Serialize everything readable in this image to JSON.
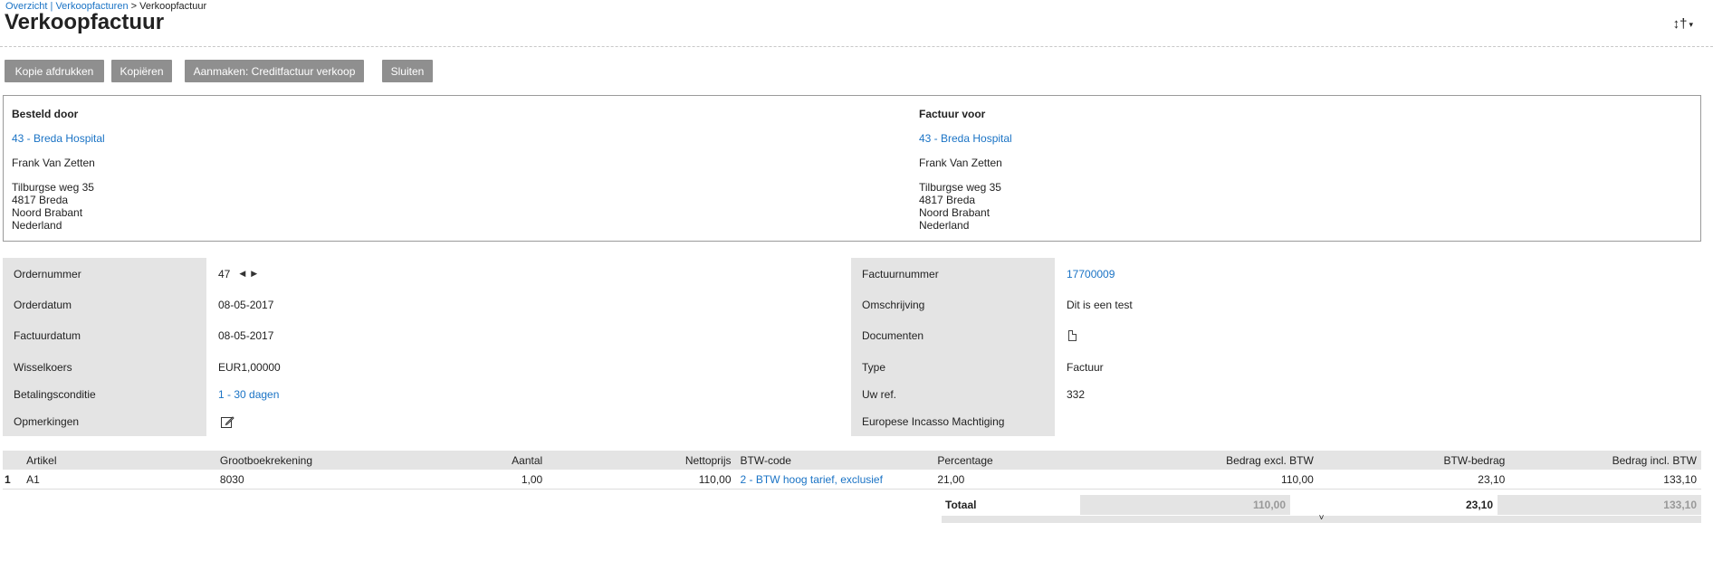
{
  "breadcrumb": {
    "item1": "Overzicht",
    "sep1": " | ",
    "item2": "Verkoopfacturen",
    "sep2": " > ",
    "current": "Verkoopfactuur"
  },
  "page": {
    "title": "Verkoopfactuur"
  },
  "tools": {
    "icon": "↕†",
    "caret": "▾"
  },
  "buttons": {
    "print": "Kopie afdrukken",
    "copy": "Kopiëren",
    "credit": "Aanmaken: Creditfactuur verkoop",
    "close": "Sluiten"
  },
  "ordered_by": {
    "heading": "Besteld door",
    "customer": "43 - Breda Hospital",
    "contact": "Frank Van Zetten",
    "street": "Tilburgse weg 35",
    "city": "4817 Breda",
    "region": "Noord Brabant",
    "country": "Nederland"
  },
  "invoice_for": {
    "heading": "Factuur voor",
    "customer": "43 - Breda Hospital",
    "contact": "Frank Van Zetten",
    "street": "Tilburgse weg 35",
    "city": "4817 Breda",
    "region": "Noord Brabant",
    "country": "Nederland"
  },
  "details_left": {
    "order_number_label": "Ordernummer",
    "order_number": "47",
    "order_date_label": "Orderdatum",
    "order_date": "08-05-2017",
    "invoice_date_label": "Factuurdatum",
    "invoice_date": "08-05-2017",
    "exchange_label": "Wisselkoers",
    "exchange": "EUR1,00000",
    "terms_label": "Betalingsconditie",
    "terms": "1 - 30 dagen",
    "remarks_label": "Opmerkingen"
  },
  "details_right": {
    "invoice_number_label": "Factuurnummer",
    "invoice_number": "17700009",
    "description_label": "Omschrijving",
    "description": "Dit is een test",
    "documents_label": "Documenten",
    "type_label": "Type",
    "type": "Factuur",
    "ref_label": "Uw ref.",
    "ref": "332",
    "sepa_label": "Europese Incasso Machtiging"
  },
  "lines": {
    "headers": {
      "article": "Artikel",
      "ledger": "Grootboekrekening",
      "qty": "Aantal",
      "net": "Nettoprijs",
      "vat_code": "BTW-code",
      "pct": "Percentage",
      "excl": "Bedrag excl. BTW",
      "vat": "BTW-bedrag",
      "incl": "Bedrag incl. BTW"
    },
    "rows": [
      {
        "no": "1",
        "article": "A1",
        "ledger": "8030",
        "qty": "1,00",
        "net": "110,00",
        "vat_code": "2 - BTW hoog tarief, exclusief",
        "pct": "21,00",
        "excl": "110,00",
        "vat": "23,10",
        "incl": "133,10"
      }
    ]
  },
  "totals": {
    "label": "Totaal",
    "excl": "110,00",
    "vat": "23,10",
    "incl": "133,10",
    "expand": "˅"
  },
  "colors": {
    "link": "#1a73c5",
    "label_bg": "#e4e4e4",
    "button_bg": "#8f8f8f"
  }
}
